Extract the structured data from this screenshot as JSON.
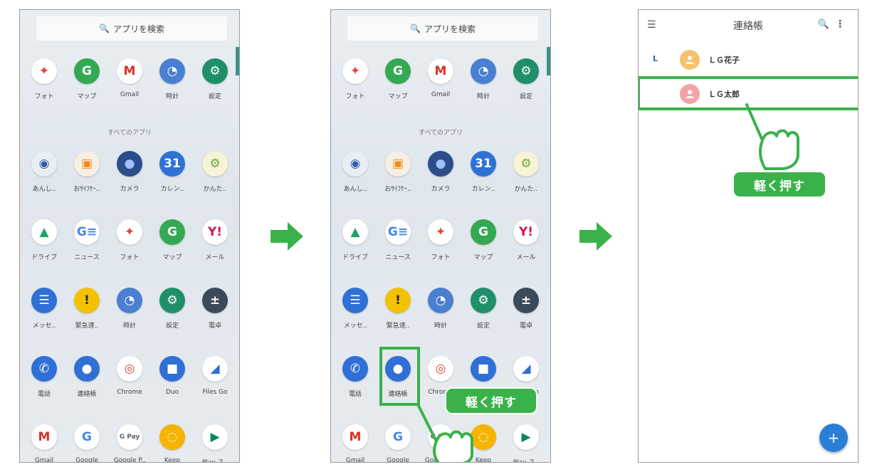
{
  "search_placeholder": "アプリを検索",
  "section_all_apps": "すべてのアプリ",
  "tap_badge": "軽く押す",
  "contacts_title": "連絡帳",
  "contacts": [
    {
      "letter": "L",
      "name": "ＬＧ花子",
      "avatar_color": "#f6c16a"
    },
    {
      "letter": "",
      "name": "ＬＧ太郎",
      "avatar_color": "#f2a3a6"
    }
  ],
  "apps": [
    {
      "label": "フォト",
      "icon": "photos-icon",
      "color": "#ffffff",
      "glyph": "✦",
      "fg": "#e7442f"
    },
    {
      "label": "マップ",
      "icon": "maps-icon",
      "color": "#34a853",
      "glyph": "G",
      "fg": "#fff"
    },
    {
      "label": "Gmail",
      "icon": "gmail-icon",
      "color": "#ffffff",
      "glyph": "M",
      "fg": "#d93025"
    },
    {
      "label": "時計",
      "icon": "clock-icon",
      "color": "#4a7fd1",
      "glyph": "◔",
      "fg": "#fff"
    },
    {
      "label": "設定",
      "icon": "settings-gear-icon",
      "color": "#1f8f6a",
      "glyph": "⚙",
      "fg": "#fff"
    },
    {
      "label": "あんし..",
      "icon": "anshin-icon",
      "color": "#e9eef5",
      "glyph": "◉",
      "fg": "#2f5da8"
    },
    {
      "label": "おｻｲﾌｹｰ..",
      "icon": "osaifu-icon",
      "color": "#f6f0e4",
      "glyph": "▣",
      "fg": "#f08a1c"
    },
    {
      "label": "カメラ",
      "icon": "camera-icon",
      "color": "#2c4c8c",
      "glyph": "●",
      "fg": "#9fc0ff"
    },
    {
      "label": "カレン..",
      "icon": "calendar-icon",
      "color": "#2f72d6",
      "glyph": "31",
      "fg": "#fff"
    },
    {
      "label": "かんた..",
      "icon": "kantan-icon",
      "color": "#f7f3d8",
      "glyph": "⚙",
      "fg": "#6fae2f"
    },
    {
      "label": "ドライブ",
      "icon": "drive-icon",
      "color": "#ffffff",
      "glyph": "▲",
      "fg": "#1fa463"
    },
    {
      "label": "ニュース",
      "icon": "news-icon",
      "color": "#ffffff",
      "glyph": "G≡",
      "fg": "#4285f4"
    },
    {
      "label": "フォト",
      "icon": "photos-icon",
      "color": "#ffffff",
      "glyph": "✦",
      "fg": "#e7442f"
    },
    {
      "label": "マップ",
      "icon": "maps-icon",
      "color": "#34a853",
      "glyph": "G",
      "fg": "#fff"
    },
    {
      "label": "メール",
      "icon": "yahoo-mail-icon",
      "color": "#ffffff",
      "glyph": "Y!",
      "fg": "#d4145a"
    },
    {
      "label": "メッセ..",
      "icon": "messages-icon",
      "color": "#2f6fd6",
      "glyph": "☰",
      "fg": "#fff"
    },
    {
      "label": "緊急速..",
      "icon": "emergency-icon",
      "color": "#f2c200",
      "glyph": "!",
      "fg": "#222"
    },
    {
      "label": "時計",
      "icon": "clock-icon",
      "color": "#4a7fd1",
      "glyph": "◔",
      "fg": "#fff"
    },
    {
      "label": "設定",
      "icon": "settings-gear-icon",
      "color": "#1f8f6a",
      "glyph": "⚙",
      "fg": "#fff"
    },
    {
      "label": "電卓",
      "icon": "calculator-icon",
      "color": "#3b4a5a",
      "glyph": "±",
      "fg": "#fff"
    },
    {
      "label": "電話",
      "icon": "phone-icon",
      "color": "#2f6fd6",
      "glyph": "✆",
      "fg": "#fff"
    },
    {
      "label": "連絡帳",
      "icon": "contacts-icon",
      "color": "#2f6fd6",
      "glyph": "●",
      "fg": "#fff"
    },
    {
      "label": "Chrome",
      "icon": "chrome-icon",
      "color": "#ffffff",
      "glyph": "◎",
      "fg": "#db4437"
    },
    {
      "label": "Duo",
      "icon": "duo-icon",
      "color": "#2f6fd6",
      "glyph": "■",
      "fg": "#fff"
    },
    {
      "label": "Files Go",
      "icon": "files-go-icon",
      "color": "#ffffff",
      "glyph": "◢",
      "fg": "#2f6fd6"
    },
    {
      "label": "Gmail",
      "icon": "gmail-icon",
      "color": "#ffffff",
      "glyph": "M",
      "fg": "#d93025"
    },
    {
      "label": "Google",
      "icon": "google-icon",
      "color": "#ffffff",
      "glyph": "G",
      "fg": "#4285f4"
    },
    {
      "label": "Google P..",
      "icon": "google-pay-icon",
      "color": "#ffffff",
      "glyph": "G Pay",
      "fg": "#5f6368"
    },
    {
      "label": "Keep",
      "icon": "keep-icon",
      "color": "#f6b400",
      "glyph": "◌",
      "fg": "#fff"
    },
    {
      "label": "Play ス..",
      "icon": "play-store-icon",
      "color": "#ffffff",
      "glyph": "▶",
      "fg": "#01875f"
    }
  ],
  "colors": {
    "accent_green": "#3ab24a",
    "fab_blue": "#2b7ed6"
  }
}
